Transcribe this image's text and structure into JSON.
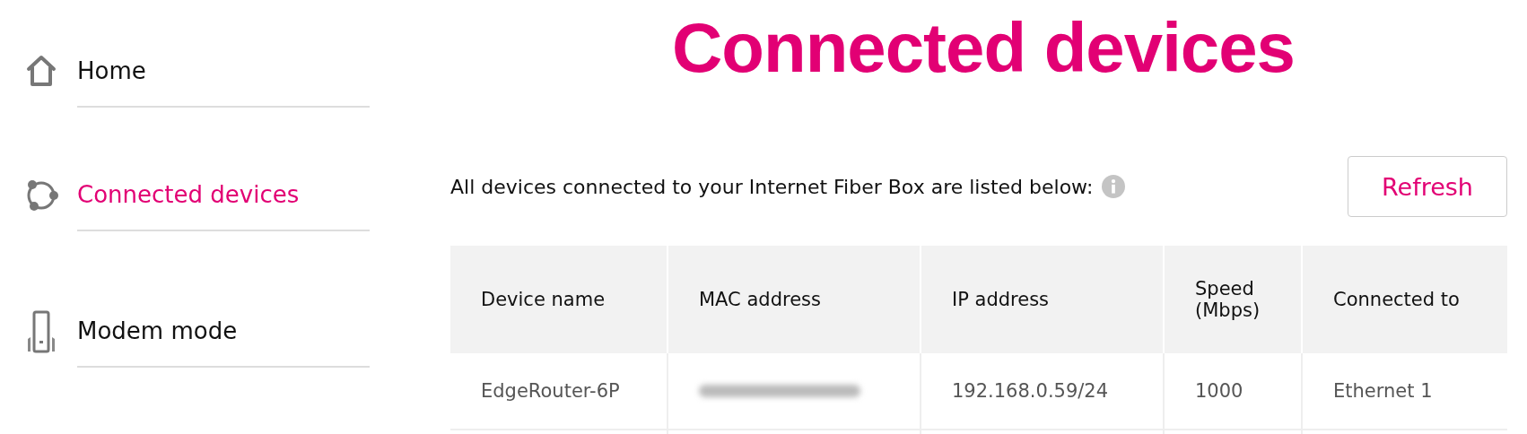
{
  "sidebar": {
    "items": [
      {
        "label": "Home",
        "kind": "home",
        "selected": false
      },
      {
        "label": "Connected devices",
        "kind": "devices",
        "selected": true
      },
      {
        "label": "Modem mode",
        "kind": "modem",
        "selected": false
      }
    ]
  },
  "page": {
    "title": "Connected devices",
    "description": "All devices connected to your Internet Fiber Box are listed below:",
    "refresh_button": "Refresh"
  },
  "table": {
    "columns": [
      "Device name",
      "MAC address",
      "IP address",
      "Speed (Mbps)",
      "Connected to"
    ],
    "rows": [
      {
        "device_name": "EdgeRouter-6P",
        "mac_address_redacted": true,
        "ip_address": "192.168.0.59/24",
        "speed": "1000",
        "connected_to": "Ethernet 1"
      }
    ]
  }
}
